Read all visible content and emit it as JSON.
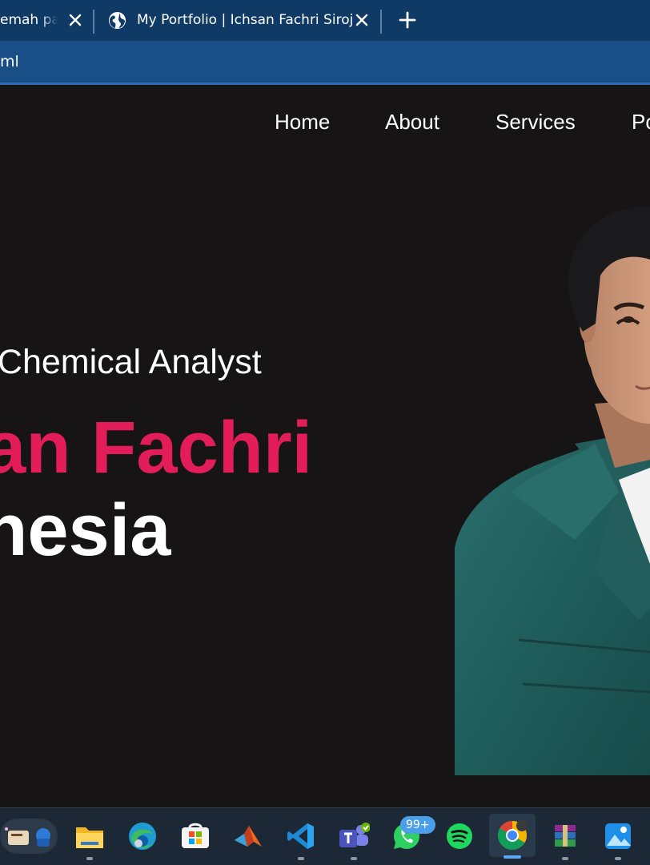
{
  "browser": {
    "tabs": [
      {
        "title": "emah pali",
        "active": false
      },
      {
        "title": "My Portfolio | Ichsan Fachri Siroj",
        "active": true
      }
    ],
    "address": "ml",
    "colors": {
      "tabstrip": "#0f3a66",
      "toolbar": "#1a4e87"
    }
  },
  "nav": {
    "items": [
      "Home",
      "About",
      "Services",
      "Po"
    ]
  },
  "hero": {
    "subtitle": "ng | Chemical Analyst",
    "name": "san Fachri",
    "country": "onesia",
    "colors": {
      "accent": "#e21d5a",
      "background": "#171415"
    }
  },
  "taskbar": {
    "apps": [
      {
        "icon": "widgets-icon"
      },
      {
        "icon": "file-explorer-icon"
      },
      {
        "icon": "edge-icon"
      },
      {
        "icon": "microsoft-store-icon"
      },
      {
        "icon": "matlab-icon"
      },
      {
        "icon": "vscode-icon"
      },
      {
        "icon": "teams-icon"
      },
      {
        "icon": "whatsapp-icon"
      },
      {
        "icon": "spotify-icon"
      },
      {
        "icon": "chrome-icon",
        "active": true
      },
      {
        "icon": "winrar-icon"
      },
      {
        "icon": "photos-icon"
      }
    ],
    "whatsapp_badge": "99+"
  }
}
